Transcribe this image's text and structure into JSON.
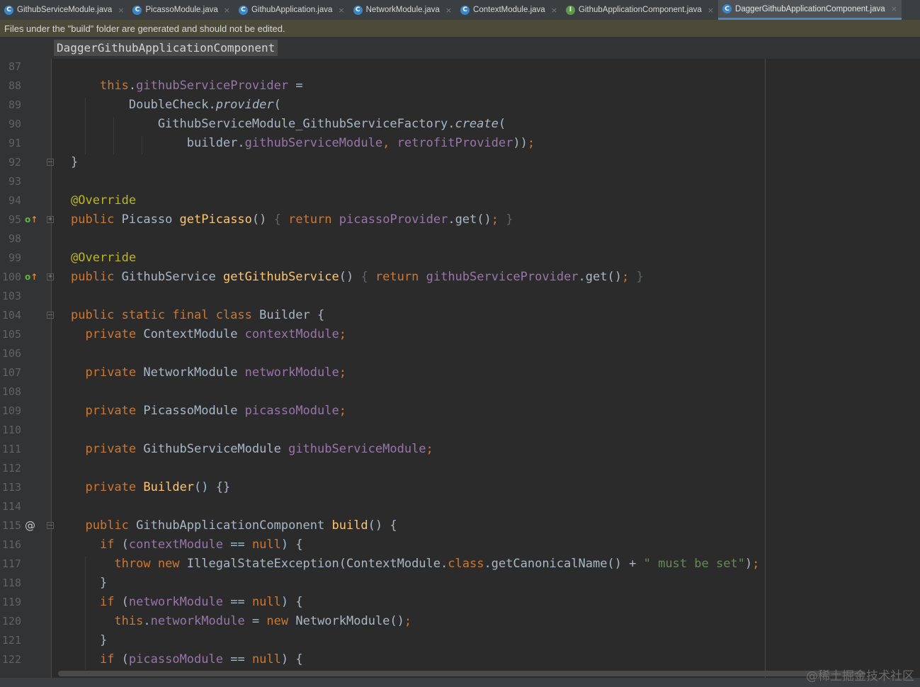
{
  "tabs": [
    {
      "label": "GithubServiceModule.java",
      "icon": "class-icon"
    },
    {
      "label": "PicassoModule.java",
      "icon": "class-icon"
    },
    {
      "label": "GithubApplication.java",
      "icon": "class-icon"
    },
    {
      "label": "NetworkModule.java",
      "icon": "class-icon"
    },
    {
      "label": "ContextModule.java",
      "icon": "class-icon"
    },
    {
      "label": "GithubApplicationComponent.java",
      "icon": "interface-icon"
    },
    {
      "label": "DaggerGithubApplicationComponent.java",
      "icon": "class-icon",
      "active": true
    }
  ],
  "notice": "Files under the \"build\" folder are generated and should not be edited.",
  "breadcrumb": "DaggerGithubApplicationComponent",
  "line_numbers": [
    "87",
    "88",
    "89",
    "90",
    "91",
    "92",
    "93",
    "94",
    "95",
    "98",
    "99",
    "100",
    "103",
    "104",
    "105",
    "106",
    "107",
    "108",
    "109",
    "110",
    "111",
    "112",
    "113",
    "114",
    "115",
    "116",
    "117",
    "118",
    "119",
    "120",
    "121",
    "122"
  ],
  "watermark": "@稀土掘金技术社区",
  "colors": {
    "background": "#2b2b2b",
    "gutter": "#313335",
    "keyword": "#cc7832",
    "field": "#9876aa",
    "method": "#ffc66d",
    "annotation": "#bbb529",
    "string": "#6a8759",
    "text": "#a9b7c6",
    "notice_bg": "#4c4a38"
  }
}
